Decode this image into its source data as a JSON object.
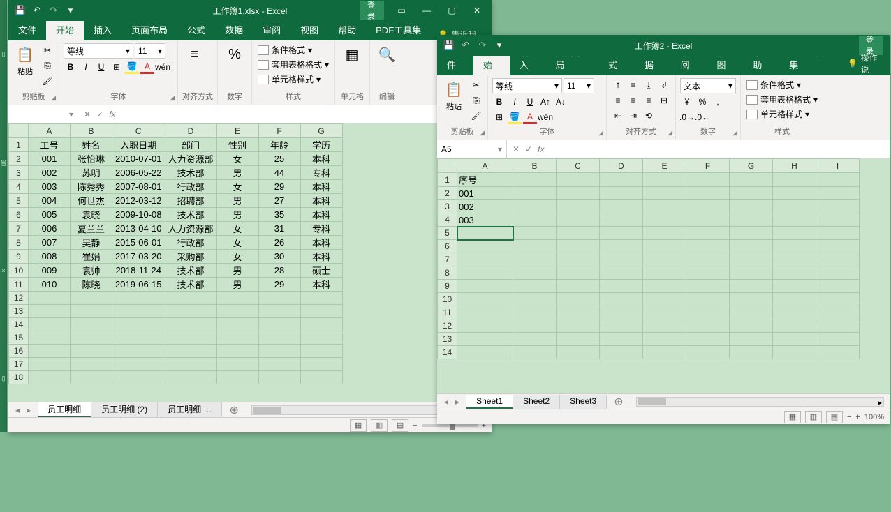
{
  "win1": {
    "title": "工作簿1.xlsx - Excel",
    "login": "登录",
    "tabs": {
      "file": "文件",
      "home": "开始",
      "insert": "插入",
      "layout": "页面布局",
      "formulas": "公式",
      "data": "数据",
      "review": "审阅",
      "view": "视图",
      "help": "帮助",
      "pdf": "PDF工具集",
      "tellme": "告诉我"
    },
    "ribbon": {
      "clipboard": "剪贴板",
      "paste": "粘贴",
      "font_group": "字体",
      "font_name": "等线",
      "font_size": "11",
      "align_group": "对齐方式",
      "number_group": "数字",
      "styles_group": "样式",
      "cond_fmt": "条件格式",
      "table_fmt": "套用表格格式",
      "cell_styles": "单元格样式",
      "cells_group": "单元格",
      "editing_group": "编辑"
    },
    "namebox": "",
    "sheet_tabs": [
      "员工明细",
      "员工明细 (2)",
      "员工明细 …"
    ],
    "grid": {
      "cols": [
        "A",
        "B",
        "C",
        "D",
        "E",
        "F",
        "G"
      ],
      "headers": [
        "工号",
        "姓名",
        "入职日期",
        "部门",
        "性别",
        "年龄",
        "学历"
      ],
      "rows": [
        [
          "001",
          "张怡琳",
          "2010-07-01",
          "人力资源部",
          "女",
          "25",
          "本科"
        ],
        [
          "002",
          "苏明",
          "2006-05-22",
          "技术部",
          "男",
          "44",
          "专科"
        ],
        [
          "003",
          "陈秀秀",
          "2007-08-01",
          "行政部",
          "女",
          "29",
          "本科"
        ],
        [
          "004",
          "何世杰",
          "2012-03-12",
          "招聘部",
          "男",
          "27",
          "本科"
        ],
        [
          "005",
          "袁晓",
          "2009-10-08",
          "技术部",
          "男",
          "35",
          "本科"
        ],
        [
          "006",
          "夏兰兰",
          "2013-04-10",
          "人力资源部",
          "女",
          "31",
          "专科"
        ],
        [
          "007",
          "吴静",
          "2015-06-01",
          "行政部",
          "女",
          "26",
          "本科"
        ],
        [
          "008",
          "崔娟",
          "2017-03-20",
          "采购部",
          "女",
          "30",
          "本科"
        ],
        [
          "009",
          "袁帅",
          "2018-11-24",
          "技术部",
          "男",
          "28",
          "硕士"
        ],
        [
          "010",
          "陈晓",
          "2019-06-15",
          "技术部",
          "男",
          "29",
          "本科"
        ]
      ],
      "visible_rows_total": 18
    }
  },
  "win2": {
    "title": "工作簿2 - Excel",
    "login": "登录",
    "tabs": {
      "file": "文件",
      "home": "开始",
      "insert": "插入",
      "layout": "页面布局",
      "formulas": "公式",
      "data": "数据",
      "review": "审阅",
      "view": "视图",
      "help": "帮助",
      "pdf": "PDF工具集",
      "tellme": "操作说"
    },
    "ribbon": {
      "clipboard": "剪贴板",
      "paste": "粘贴",
      "font_group": "字体",
      "font_name": "等线",
      "font_size": "11",
      "align_group": "对齐方式",
      "number_group": "数字",
      "number_format": "文本",
      "styles_group": "样式",
      "cond_fmt": "条件格式",
      "table_fmt": "套用表格格式",
      "cell_styles": "单元格样式"
    },
    "namebox": "A5",
    "sheet_tabs": [
      "Sheet1",
      "Sheet2",
      "Sheet3"
    ],
    "grid": {
      "cols": [
        "A",
        "B",
        "C",
        "D",
        "E",
        "F",
        "G",
        "H",
        "I"
      ],
      "data": {
        "A1": "序号",
        "A2": "001",
        "A3": "002",
        "A4": "003"
      },
      "visible_rows_total": 14
    },
    "zoom": "100%"
  }
}
